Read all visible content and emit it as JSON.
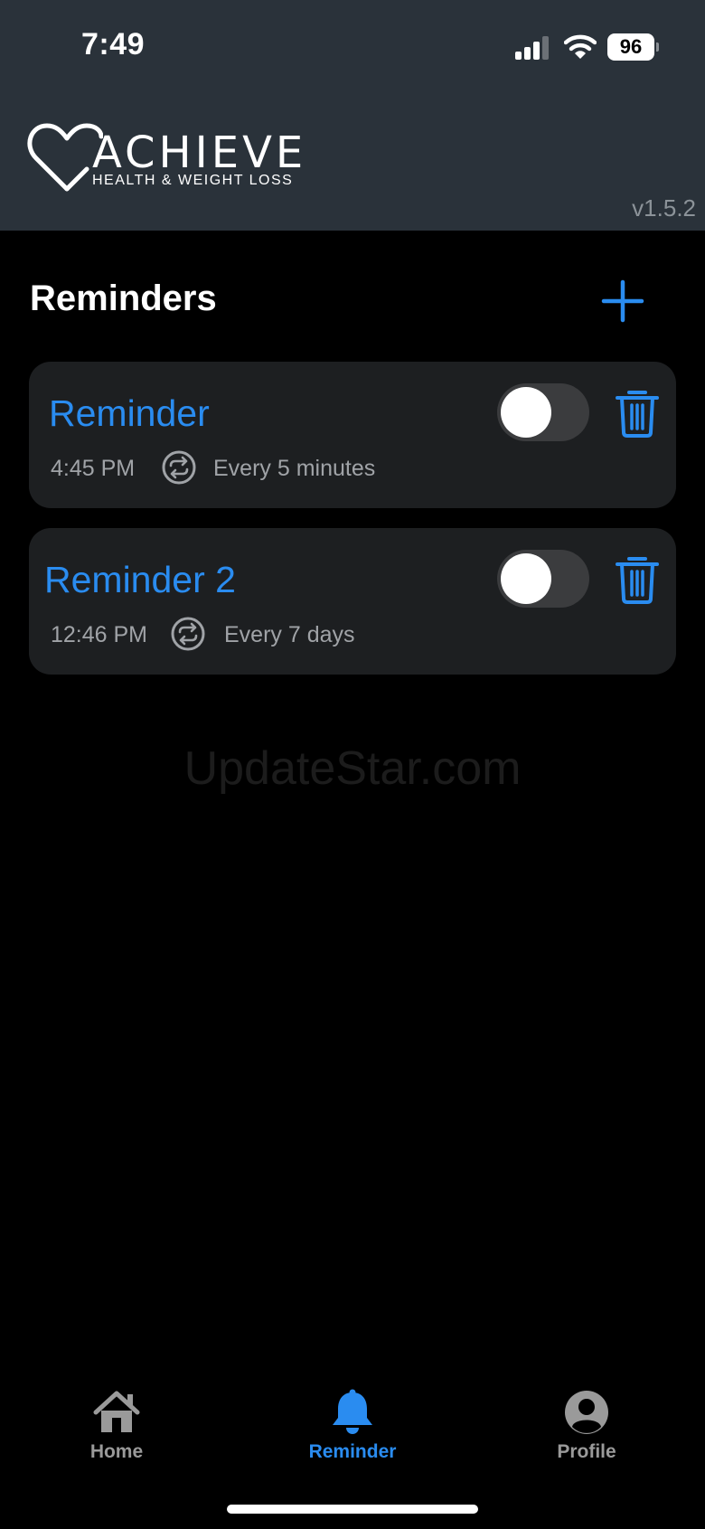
{
  "status_bar": {
    "time": "7:49",
    "battery": "96"
  },
  "header": {
    "logo_title": "ACHIEVE",
    "logo_subtitle": "HEALTH & WEIGHT LOSS",
    "version": "v1.5.2"
  },
  "reminders_section": {
    "title": "Reminders"
  },
  "reminders": [
    {
      "title": "Reminder",
      "time": "4:45 PM",
      "repeat": "Every 5 minutes",
      "enabled": false
    },
    {
      "title": "Reminder 2",
      "time": "12:46 PM",
      "repeat": "Every 7 days",
      "enabled": false
    }
  ],
  "watermark": "UpdateStar.com",
  "tab_bar": {
    "items": [
      {
        "label": "Home",
        "icon": "home-icon",
        "active": false
      },
      {
        "label": "Reminder",
        "icon": "bell-icon",
        "active": true
      },
      {
        "label": "Profile",
        "icon": "profile-icon",
        "active": false
      }
    ]
  },
  "colors": {
    "accent": "#2a8cf0",
    "header_bg": "#2a323a",
    "card_bg": "#1d1f21",
    "inactive_tab": "#9a9a9a"
  }
}
